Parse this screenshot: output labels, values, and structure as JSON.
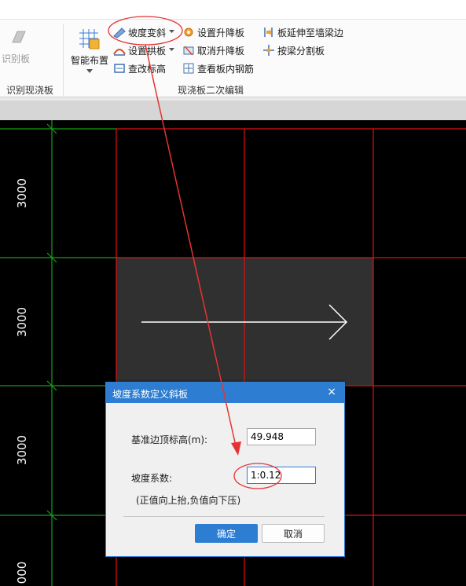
{
  "ribbon": {
    "identify_group": {
      "button_label": "识别板",
      "group_label": "识别现浇板"
    },
    "edit_group": {
      "smart_layout": "智能布置",
      "slope_incline": "坡度变斜",
      "set_arch": "设置拱板",
      "check_elevation": "查改标高",
      "set_raise_lower": "设置升降板",
      "cancel_raise_lower": "取消升降板",
      "view_rebar": "查看板内钢筋",
      "extend_to_wall": "板延伸至墙梁边",
      "split_by_beam": "按梁分割板",
      "group_label": "现浇板二次编辑"
    }
  },
  "canvas": {
    "dimension_labels": [
      "3000",
      "3000",
      "3000",
      "000"
    ]
  },
  "dialog": {
    "title": "坡度系数定义斜板",
    "close_symbol": "×",
    "elevation_label": "基准边顶标高(m):",
    "elevation_value": "49.948",
    "slope_label": "坡度系数:",
    "slope_value": "1:0.12",
    "hint": "(正值向上抬,负值向下压)",
    "ok_label": "确定",
    "cancel_label": "取消"
  },
  "colors": {
    "accent": "#2d7ed2",
    "annotation": "#e53333",
    "grid_red": "#e01010",
    "grid_green": "#16a016",
    "slab_fill": "#303030"
  }
}
